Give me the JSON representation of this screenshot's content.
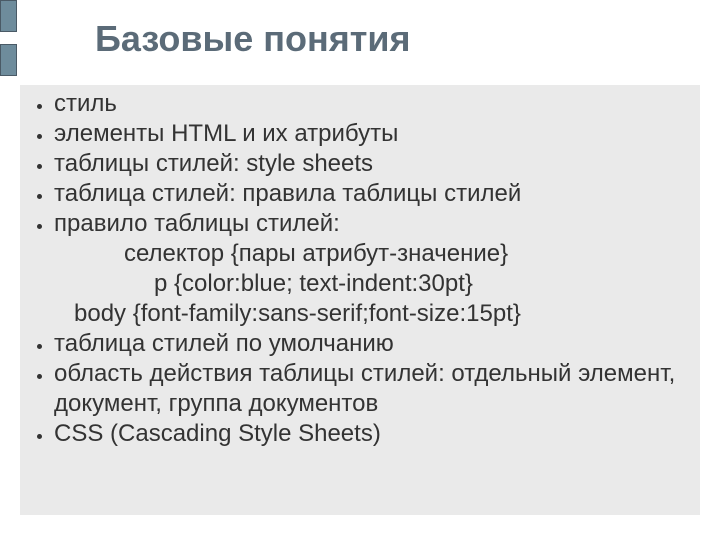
{
  "title": "Базовые понятия",
  "bullets": {
    "b0": "стиль",
    "b1": "элементы HTML и их атрибуты",
    "b2": "таблицы стилей: style sheets",
    "b3": "таблица стилей: правила таблицы стилей",
    "b4": "правило таблицы стилей:",
    "b4_sub1": "селектор {пары атрибут-значение}",
    "b4_sub2": "p {color:blue; text-indent:30pt}",
    "b4_sub3": "body {font-family:sans-serif;font-size:15pt}",
    "b5": "таблица стилей по умолчанию",
    "b6": "область действия таблицы стилей: отдельный элемент, документ, группа документов",
    "b7": "CSS (Cascading Style Sheets)"
  }
}
